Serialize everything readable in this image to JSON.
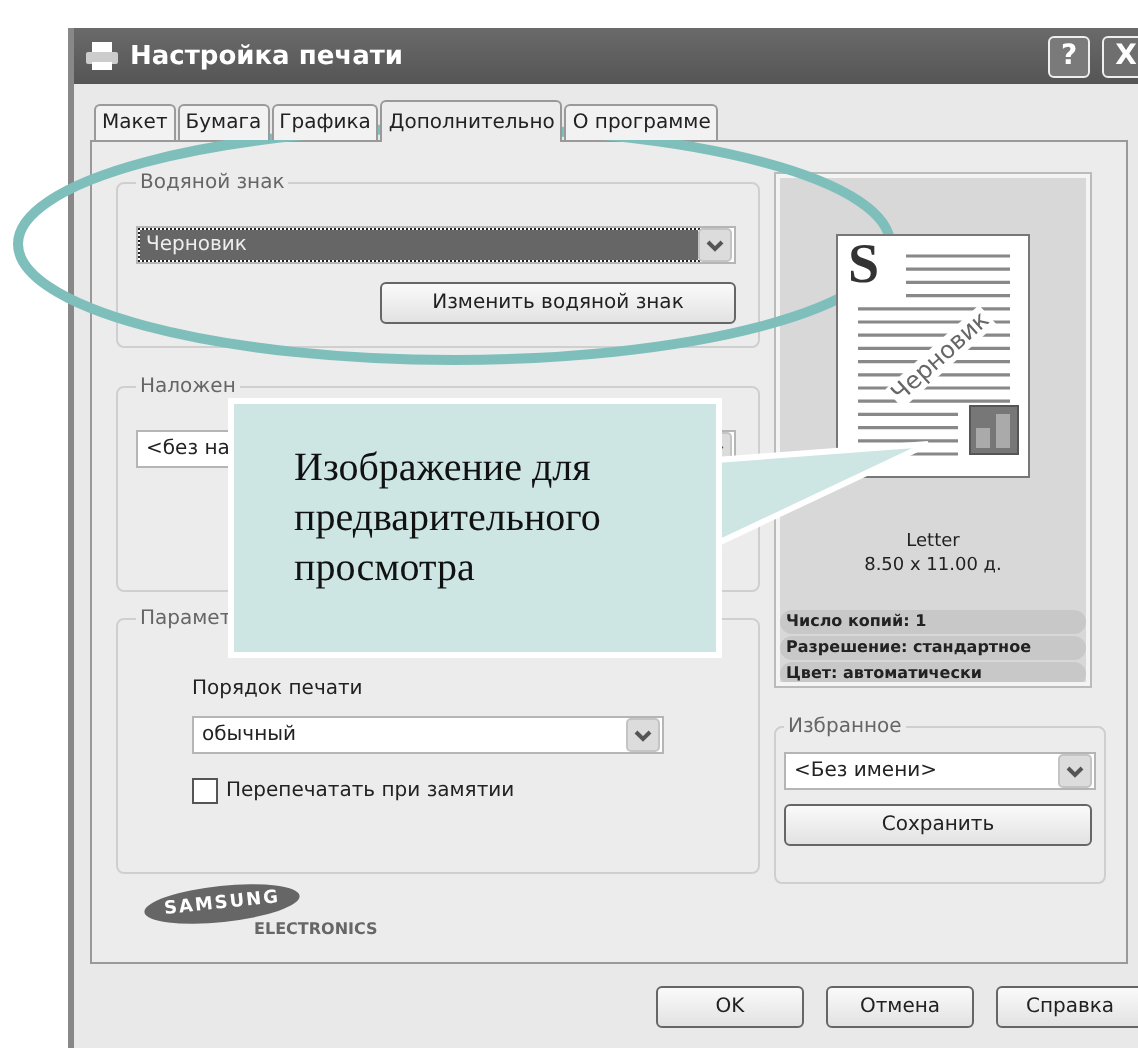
{
  "window": {
    "title": "Настройка печати",
    "caption_buttons": [
      {
        "kind": "help",
        "label": "?"
      },
      {
        "kind": "close",
        "label": "X"
      }
    ]
  },
  "tabs": [
    {
      "label": "Макет",
      "selected": false
    },
    {
      "label": "Бумага",
      "selected": false
    },
    {
      "label": "Графика",
      "selected": false
    },
    {
      "label": "Дополнительно",
      "selected": true
    },
    {
      "label": "О программе",
      "selected": false
    }
  ],
  "watermark": {
    "title": "Водяной знак",
    "dropdown": {
      "value": "Черновик",
      "focused": true
    },
    "button": "Изменить водяной знак"
  },
  "overlay": {
    "title": "Наложен",
    "dropdown": {
      "value": "<без на",
      "focused": false
    }
  },
  "print_options": {
    "title": "Парамет",
    "order_label": "Порядок печати",
    "order_dropdown": {
      "value": "обычный",
      "focused": false
    },
    "checkbox": {
      "label": "Перепечатать при замятии",
      "checked": false
    }
  },
  "preview": {
    "drop_cap": "S",
    "watermark_text": "Черновик",
    "paper": "Letter",
    "size": "8.50 x 11.00 д.",
    "info": [
      "Число копий: 1",
      "Разрешение: стандартное",
      "Цвет: автоматически"
    ]
  },
  "favorites": {
    "title": "Избранное",
    "dropdown": {
      "value": "<Без имени>",
      "focused": false
    },
    "button": "Сохранить"
  },
  "logo": {
    "brand": "SAMSUNG",
    "sub": "ELECTRONICS"
  },
  "callout": {
    "text": "Изображение для предварительного просмотра"
  },
  "buttons": [
    "OK",
    "Отмена",
    "Справка"
  ]
}
